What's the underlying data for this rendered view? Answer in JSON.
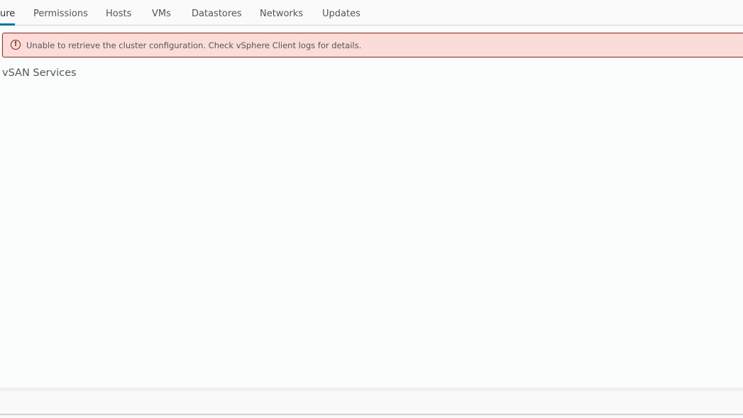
{
  "tabs": [
    {
      "label": "ure",
      "active": true
    },
    {
      "label": "Permissions"
    },
    {
      "label": "Hosts"
    },
    {
      "label": "VMs"
    },
    {
      "label": "Datastores"
    },
    {
      "label": "Networks"
    },
    {
      "label": "Updates"
    }
  ],
  "alert": {
    "icon": "error-circle-icon",
    "glyph": "!",
    "message": "Unable to retrieve the cluster configuration. Check vSphere Client logs for details.",
    "color": "#b71c0c"
  },
  "section": {
    "title": "vSAN Services"
  }
}
